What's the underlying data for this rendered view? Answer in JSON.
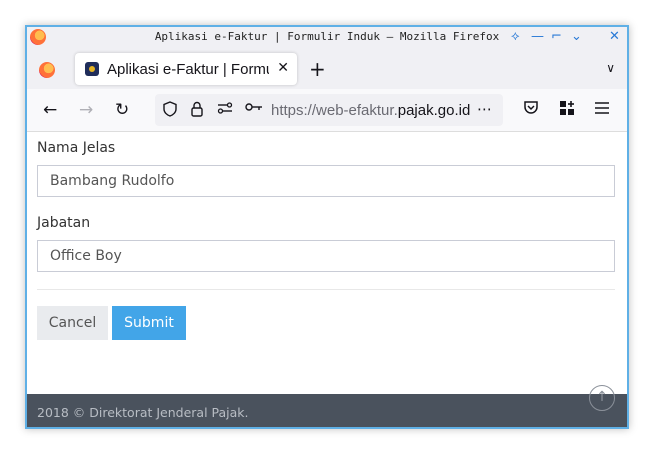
{
  "window": {
    "title": "Aplikasi e-Faktur | Formulir Induk — Mozilla Firefox",
    "controls": [
      "⟡",
      "—",
      "⌐",
      "⌄",
      "✕"
    ]
  },
  "tabs": [
    {
      "label": "Aplikasi e-Faktur | Formulir Induk",
      "close": "✕"
    }
  ],
  "tabbar": {
    "new_tab": "+",
    "list_tabs": "∨"
  },
  "navbar": {
    "back": "←",
    "forward": "→",
    "reload": "↻",
    "url_prefix": "https://web-efaktur.",
    "url_domain": "pajak.go.id",
    "more": "⋯"
  },
  "form": {
    "nama_label": "Nama Jelas",
    "nama_value": "Bambang Rudolfo",
    "jabatan_label": "Jabatan",
    "jabatan_value": "Office Boy",
    "cancel_label": "Cancel",
    "submit_label": "Submit"
  },
  "footer": {
    "text": "2018 © Direktorat Jenderal Pajak."
  },
  "colors": {
    "accent": "#42a5e8",
    "footer_bg": "#4a525d",
    "window_border": "#5fb0e6"
  }
}
